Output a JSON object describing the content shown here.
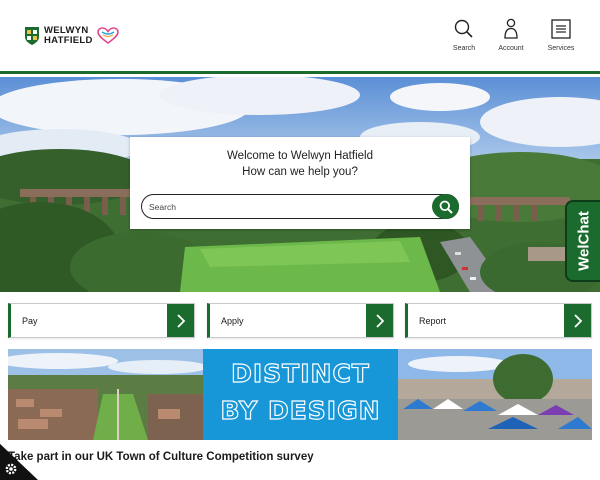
{
  "header": {
    "logo": {
      "line1": "WELWYN",
      "line2": "HATFIELD"
    },
    "nav": [
      {
        "id": "search",
        "label": "Search",
        "icon": "search-icon"
      },
      {
        "id": "account",
        "label": "Account",
        "icon": "user-icon"
      },
      {
        "id": "services",
        "label": "Services",
        "icon": "menu-icon"
      }
    ]
  },
  "hero": {
    "welcome_line1": "Welcome to Welwyn Hatfield",
    "welcome_line2": "How can we help you?",
    "search_placeholder": "Search"
  },
  "welchat": {
    "label": "WelChat"
  },
  "tiles": [
    {
      "id": "pay",
      "label": "Pay"
    },
    {
      "id": "apply",
      "label": "Apply"
    },
    {
      "id": "report",
      "label": "Report"
    }
  ],
  "banner": {
    "line1": "DISTINCT",
    "line2": "BY DESIGN"
  },
  "survey": {
    "text": "Take part in our UK Town of Culture Competition survey"
  },
  "colors": {
    "brand_green": "#1b6b2e",
    "banner_blue": "#1797d8"
  }
}
